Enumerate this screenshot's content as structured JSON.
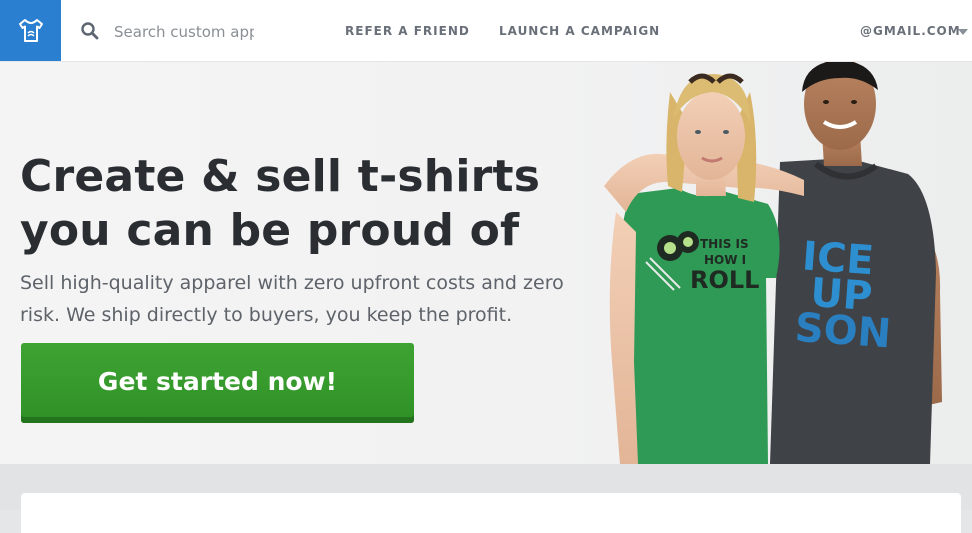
{
  "header": {
    "logo_icon": "tshirt-icon",
    "search": {
      "placeholder": "Search custom app",
      "value": "",
      "icon": "search-icon"
    },
    "nav": [
      {
        "label": "REFER A FRIEND"
      },
      {
        "label": "LAUNCH A CAMPAIGN"
      }
    ],
    "account": {
      "label": "@GMAIL.COM",
      "icon": "chevron-down-icon"
    }
  },
  "hero": {
    "headline_line1": "Create & sell t-shirts",
    "headline_line2": "you can be proud of",
    "subtext_line1": "Sell high-quality apparel with zero upfront costs and zero",
    "subtext_line2": "risk. We ship directly to buyers, you keep the profit.",
    "cta_label": "Get started now!",
    "photo": {
      "shirt1_line1": "THIS IS",
      "shirt1_line2": "HOW I",
      "shirt1_line3": "ROLL",
      "shirt2_line1": "ICE",
      "shirt2_line2": "UP",
      "shirt2_line3": "SON"
    }
  },
  "colors": {
    "brand_blue": "#2a7fd0",
    "cta_green": "#3ea333",
    "headline": "#2a2d31",
    "nav_text": "#6a7079"
  }
}
